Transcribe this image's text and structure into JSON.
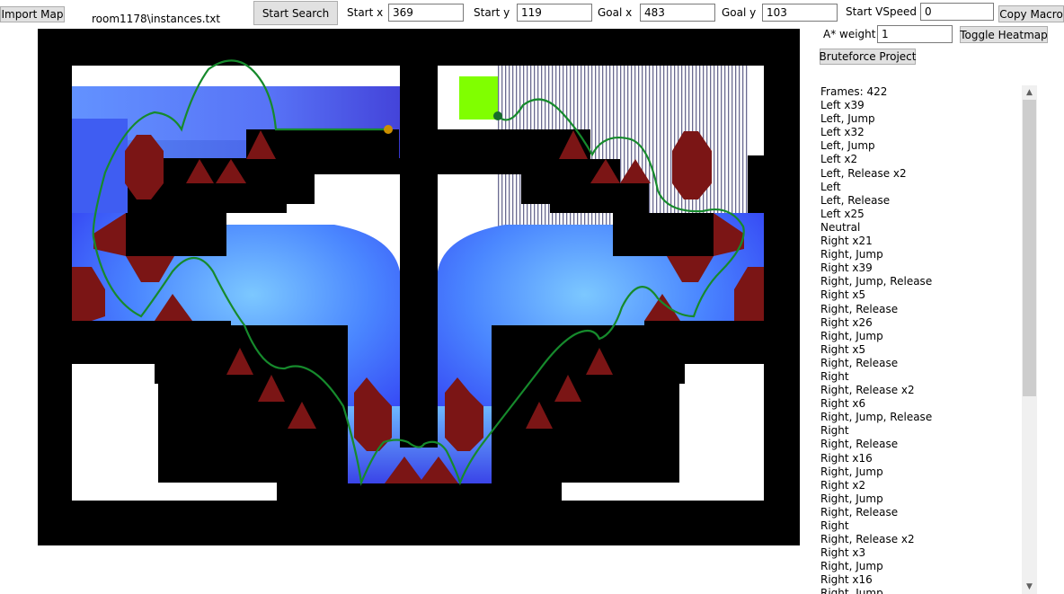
{
  "toolbar": {
    "import_map": "Import Map",
    "map_path": "room1178\\instances.txt",
    "start_search": "Start Search",
    "start_x_label": "Start x",
    "start_x": "369",
    "start_y_label": "Start y",
    "start_y": "119",
    "goal_x_label": "Goal x",
    "goal_x": "483",
    "goal_y_label": "Goal y",
    "goal_y": "103",
    "start_vspeed_label": "Start VSpeed",
    "start_vspeed": "0",
    "copy_macro": "Copy Macro",
    "astar_weight_label": "A* weight",
    "astar_weight": "1",
    "toggle_heatmap": "Toggle Heatmap",
    "bruteforce_project": "Bruteforce Project"
  },
  "colors": {
    "wall": "#000000",
    "spike": "#7b1515",
    "goal": "#80ff00",
    "path": "#168a2c",
    "start_marker": "#cc8f00",
    "goal_marker": "#176b2c",
    "heat_dark": "#2a2cff",
    "heat_light": "#5fb8ff"
  },
  "log": {
    "frames_label": "Frames: 422",
    "rows": [
      "Left x39",
      "Left, Jump",
      "Left x32",
      "Left, Jump",
      "Left x2",
      "Left, Release x2",
      "Left",
      "Left, Release",
      "Left x25",
      "Neutral",
      "Right x21",
      "Right, Jump",
      "Right x39",
      "Right, Jump, Release",
      "Right x5",
      "Right, Release",
      "Right x26",
      "Right, Jump",
      "Right x5",
      "Right, Release",
      "Right",
      "Right, Release x2",
      "Right x6",
      "Right, Jump, Release",
      "Right",
      "Right, Release",
      "Right x16",
      "Right, Jump",
      "Right x2",
      "Right, Jump",
      "Right, Release",
      "Right",
      "Right, Release x2",
      "Right x3",
      "Right, Jump",
      "Right x16",
      "Right, Jump"
    ]
  },
  "scrollbar": {
    "up_icon": "▲",
    "down_icon": "▼"
  }
}
